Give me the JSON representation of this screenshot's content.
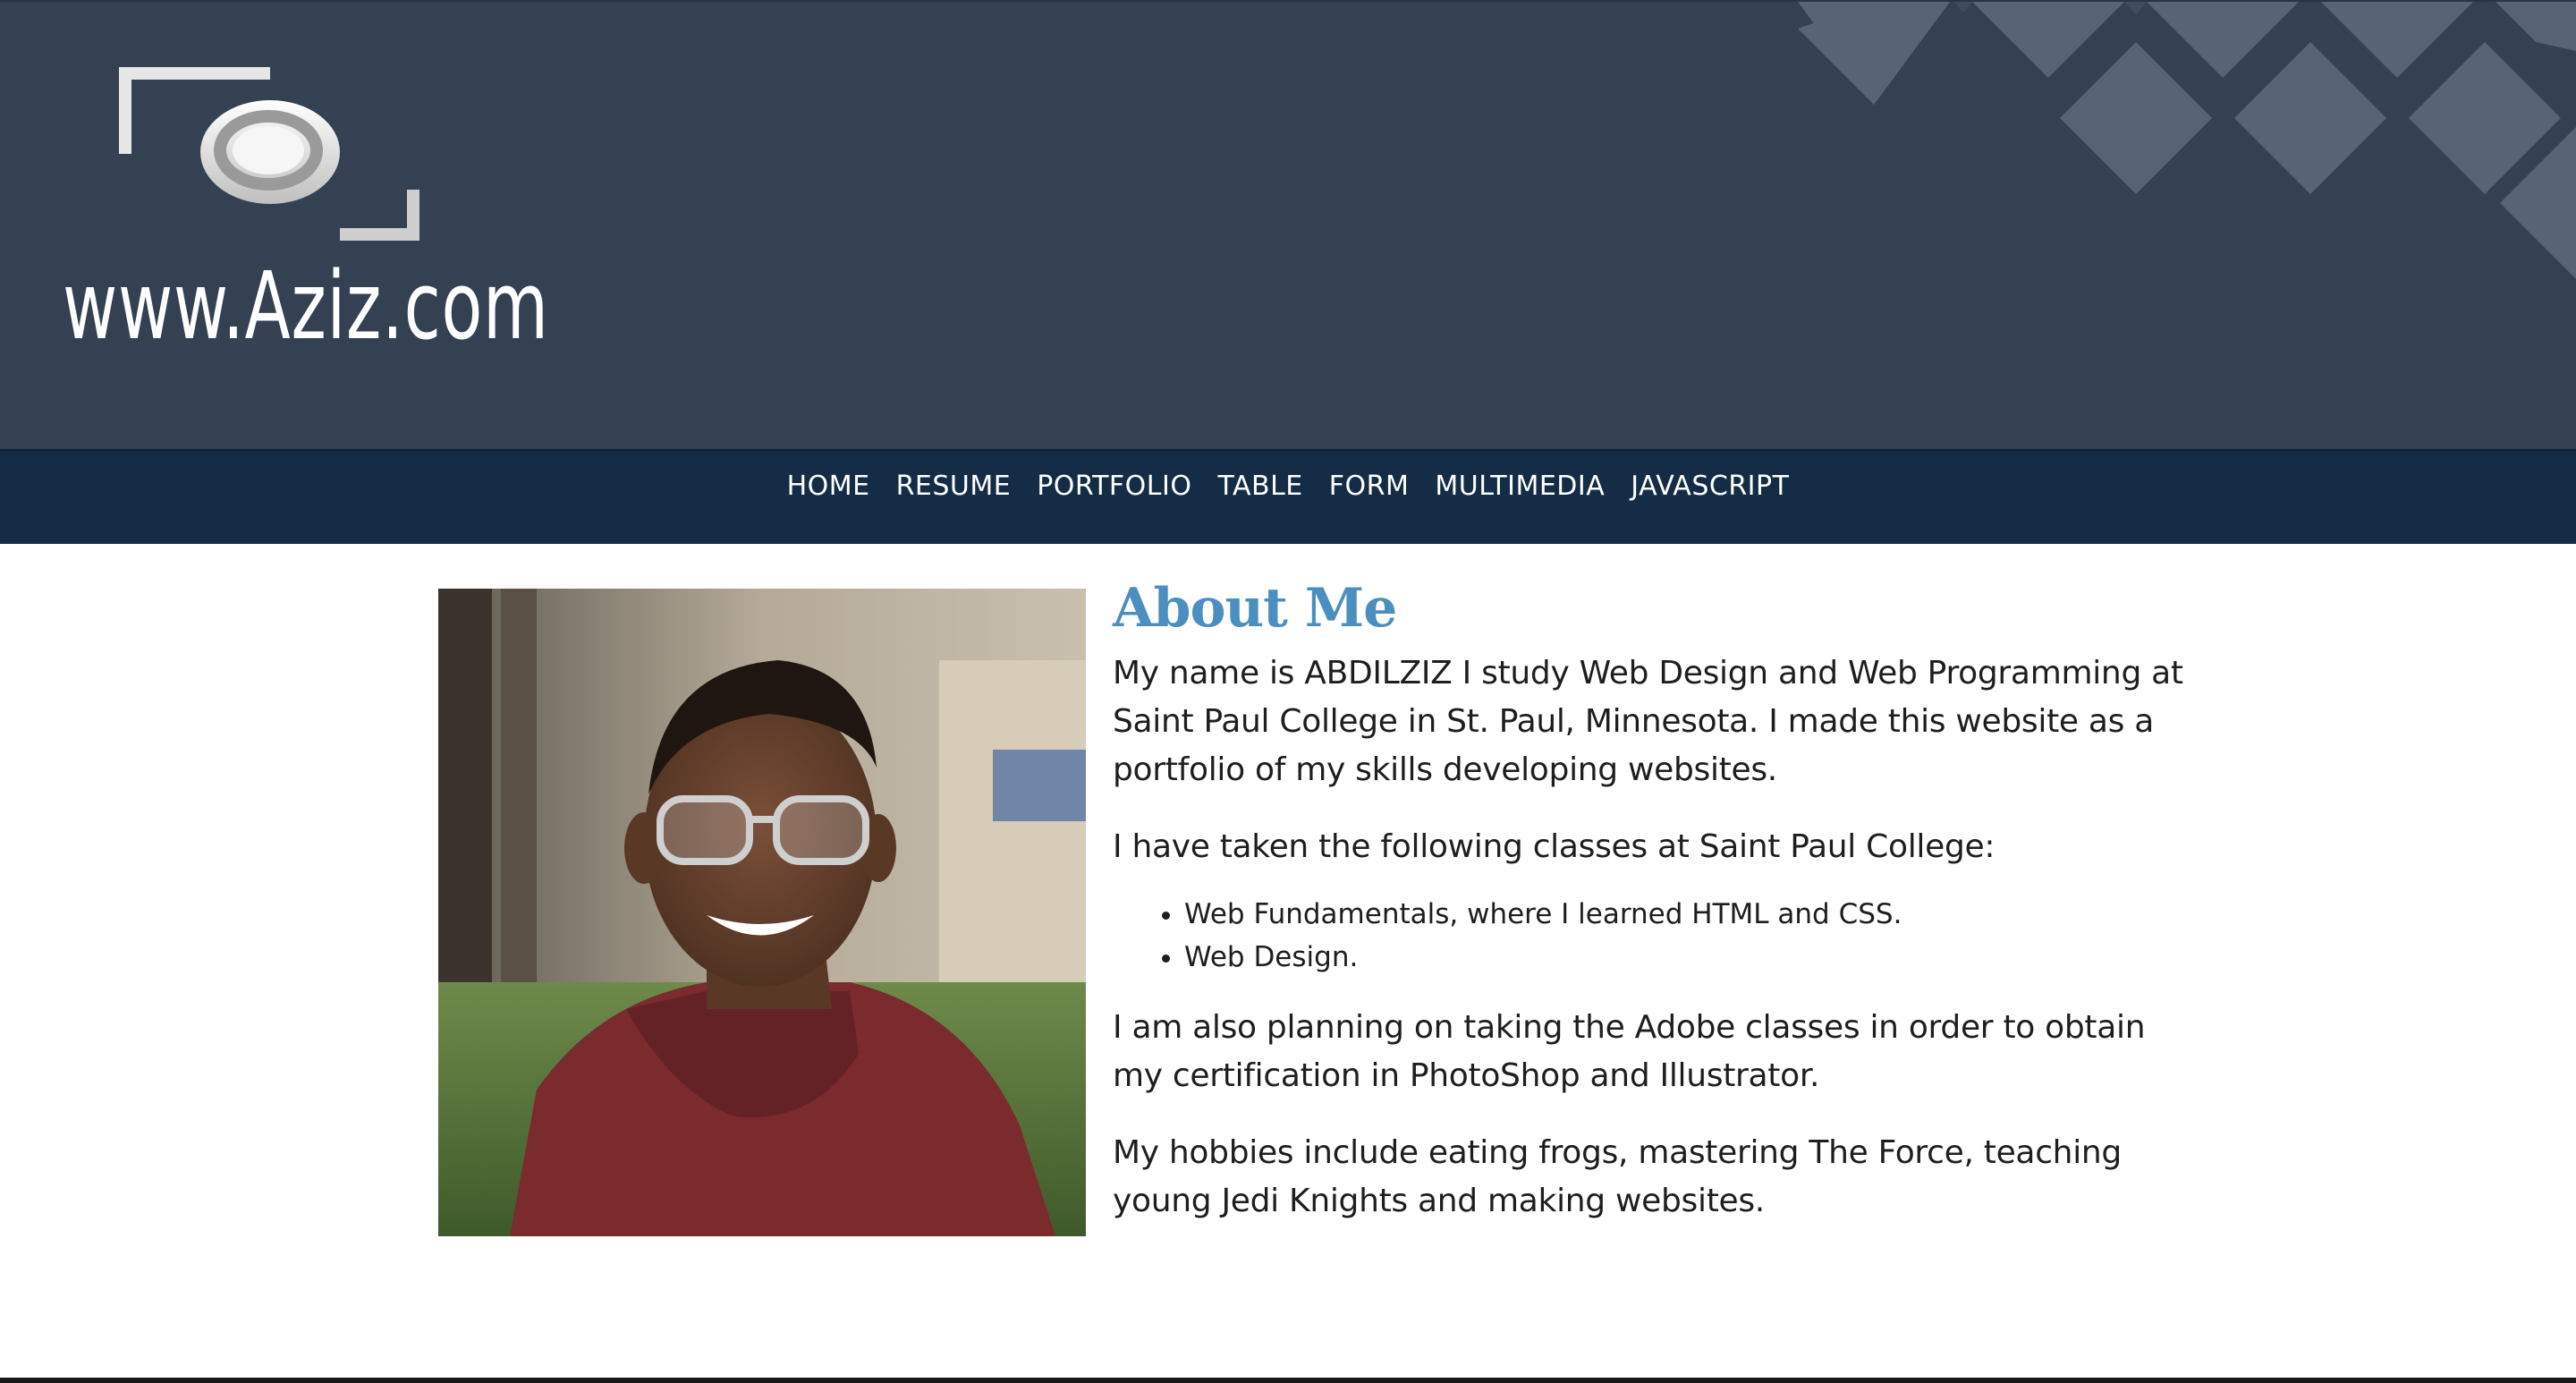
{
  "header": {
    "logo_text": "www.Aziz.com",
    "background_color": "#344153",
    "icon": "camera-viewfinder-icon"
  },
  "nav": {
    "background_color": "#142c45",
    "items": [
      {
        "label": "HOME"
      },
      {
        "label": "RESUME"
      },
      {
        "label": "PORTFOLIO"
      },
      {
        "label": "TABLE"
      },
      {
        "label": "FORM"
      },
      {
        "label": "MULTIMEDIA"
      },
      {
        "label": "JAVASCRIPT"
      }
    ]
  },
  "about": {
    "heading": "About Me",
    "heading_color": "#4a8fc0",
    "paragraph1": "My name is ABDILZIZ I study Web Design and Web Programming at Saint Paul College in St. Paul, Minnesota. I made this website as a portfolio of my skills developing websites.",
    "paragraph2": "I have taken the following classes at Saint Paul College:",
    "classes": [
      "Web Fundamentals, where I learned HTML and CSS.",
      "Web Design."
    ],
    "paragraph3": "I am also planning on taking the Adobe classes in order to obtain my certification in PhotoShop and Illustrator.",
    "paragraph4": "My hobbies include eating frogs, mastering The Force, teaching young Jedi Knights and making websites."
  }
}
